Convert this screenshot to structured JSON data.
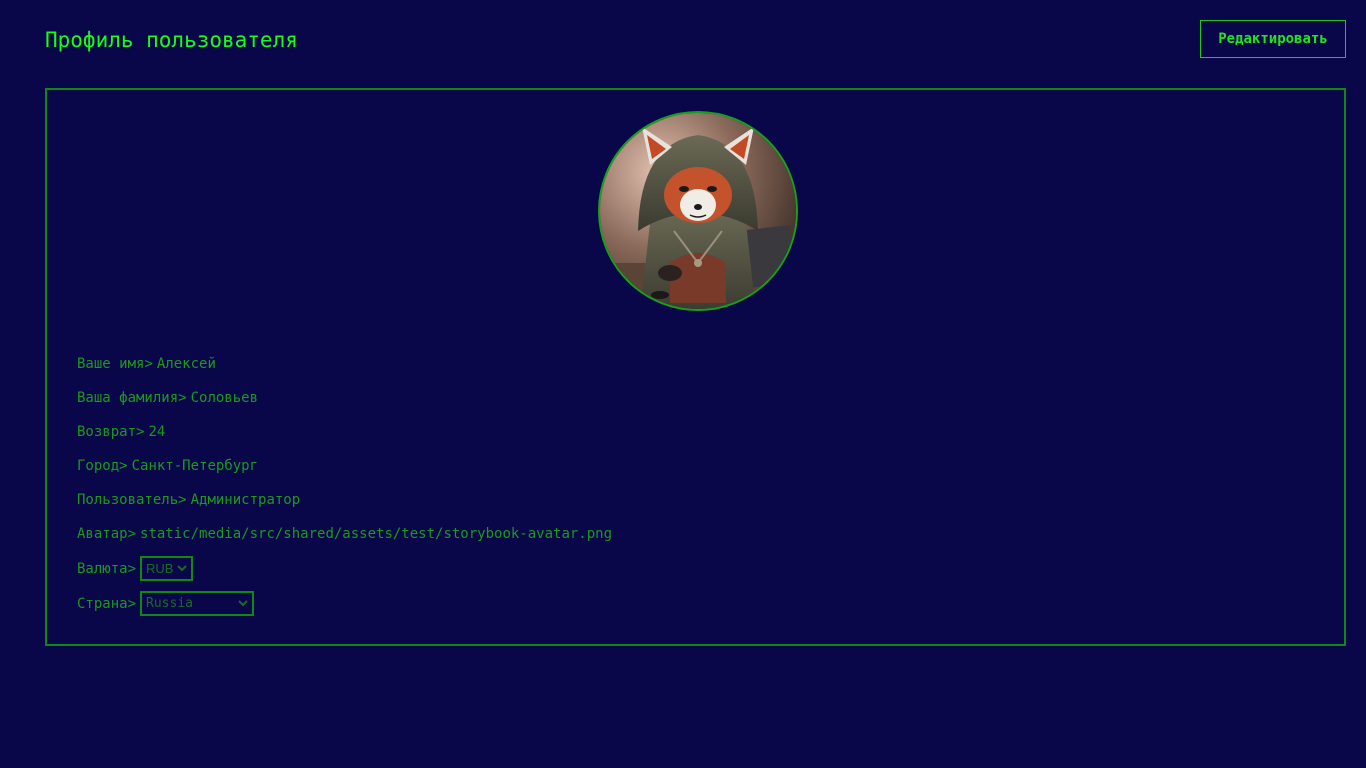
{
  "header": {
    "title": "Профиль пользователя",
    "edit_label": "Редактировать"
  },
  "profile": {
    "avatar_alt": "storybook-avatar",
    "fields": [
      {
        "label": "Ваше имя",
        "value": "Алексей"
      },
      {
        "label": "Ваша фамилия",
        "value": "Соловьев"
      },
      {
        "label": "Возврат",
        "value": "24"
      },
      {
        "label": "Город",
        "value": "Санкт-Петербург"
      },
      {
        "label": "Пользователь",
        "value": "Администратор"
      },
      {
        "label": "Аватар",
        "value": "static/media/src/shared/assets/test/storybook-avatar.png"
      }
    ],
    "currency": {
      "label": "Валюта",
      "value": "RUB"
    },
    "country": {
      "label": "Страна",
      "value": "Russia"
    },
    "separator": ">"
  },
  "colors": {
    "background": "#090649",
    "title": "#14ff14",
    "text": "#1b9a1b",
    "border": "#0e8a12"
  }
}
